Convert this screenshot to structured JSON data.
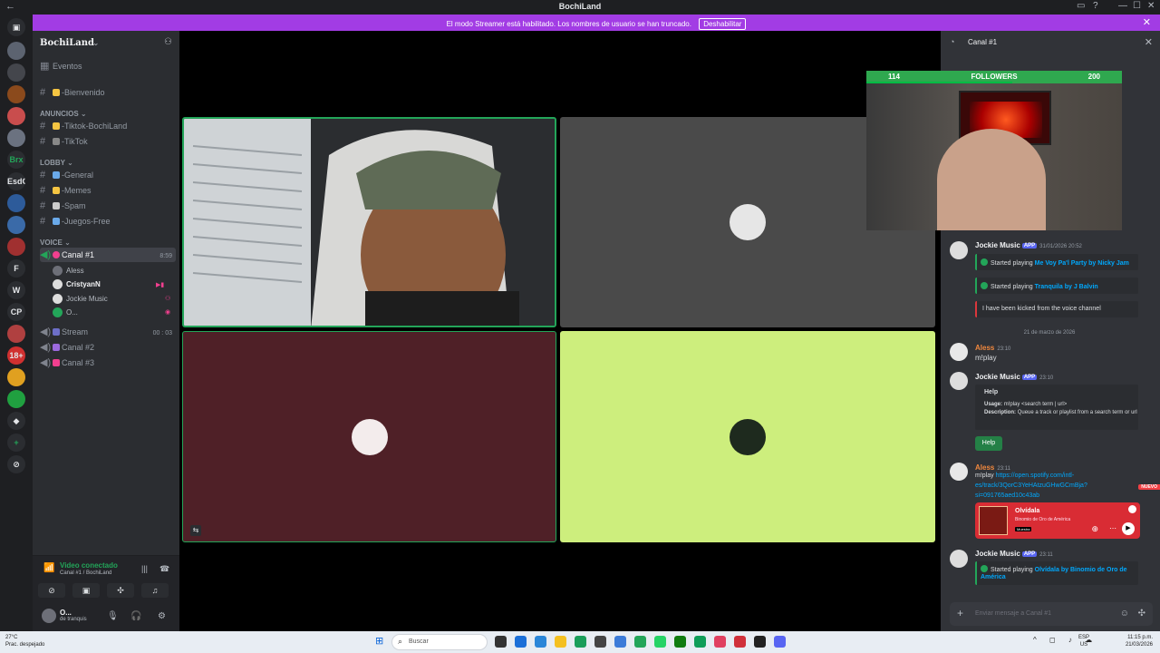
{
  "window": {
    "title": "BochiLand",
    "minimize": "—",
    "maximize": "☐",
    "close": "✕"
  },
  "banner": {
    "message": "El modo Streamer está habilitado. Los nombres de usuario se han truncado.",
    "button": "Deshabilitar"
  },
  "rail": {
    "items": [
      "",
      "",
      "",
      "",
      "",
      "",
      "",
      "Brx",
      "EsdC",
      "",
      "",
      "",
      "F",
      "W",
      "CP",
      "",
      "18+",
      "",
      "",
      "",
      "+",
      ""
    ]
  },
  "server": {
    "name": "BochiLand",
    "events": "Eventos",
    "channels": {
      "bienvenido": "-Bienvenido",
      "anuncios_cat": "ANUNCIOS",
      "tiktok": "-Tiktok-BochiLand",
      "tiktok2": "-TikTok",
      "lobby_cat": "LOBBY",
      "general": "-General",
      "memes": "-Memes",
      "spam": "-Spam",
      "juegos": "-Juegos-Free",
      "voice_cat": "VOICE",
      "canal1": "Canal #1",
      "canal1_time": "8:59",
      "stream": "Stream",
      "stream_time": "00 : 03",
      "canal2": "Canal #2",
      "canal3": "Canal #3"
    },
    "voice_members": [
      "Aless",
      "CristyanN",
      "Jockie Music",
      "O..."
    ]
  },
  "voice_panel": {
    "title": "Video conectado",
    "subtitle": "Canal #1 / BochiLand",
    "buttons": [
      "camera-off",
      "screen-share",
      "activities",
      "soundboard"
    ]
  },
  "user_panel": {
    "name": "O...",
    "status": "de tranquis"
  },
  "chat": {
    "channel": "Canal #1",
    "messages": [
      {
        "author": "Jockie Music",
        "app": "APP",
        "time": "31/01/2026 20:52"
      },
      {
        "line1_prefix": "Started playing ",
        "line1_link": "Me Voy Pa'l Party by Nicky Jam"
      },
      {
        "line_prefix": "Started playing ",
        "line_link": "Tranquila by J Balvin"
      },
      {
        "kicked": "I have been kicked from the voice channel"
      }
    ],
    "date_separator": "21 de marzo de 2026",
    "aless1": {
      "author": "Aless",
      "time": "23:10",
      "text": "m!play"
    },
    "jockie2": {
      "author": "Jockie Music",
      "app": "APP",
      "time": "23:10",
      "embed_title": "Help",
      "usage_label": "Usage:",
      "usage_text": "m!play <search term | url>",
      "desc_label": "Description:",
      "desc_text": "Queue a track or playlist from a search term or url",
      "button": "Help"
    },
    "new_badge": "NUEVO",
    "aless2": {
      "author": "Aless",
      "time": "23:11",
      "text_prefix": "m!play ",
      "link1": "https://open.spotify.com/intl-",
      "link2": "es/track/3QorC3YeHAtzuGHwGCmBja?",
      "link3": "si=091765aed10c43ab"
    },
    "spotify": {
      "title": "Olvídala",
      "artist": "Binomio de Oro de América",
      "preview": "Muestra"
    },
    "jockie3": {
      "author": "Jockie Music",
      "app": "APP",
      "time": "23:11",
      "prefix": "Started playing ",
      "link": "Olvídala by Binomio de Oro de",
      "link2": "América"
    },
    "input_placeholder": "Enviar mensaje a  Canal #1"
  },
  "overlay": {
    "followers_current": "114",
    "followers_label": "FOLLOWERS",
    "followers_goal": "200",
    "progress": 0.57
  },
  "taskbar": {
    "temp": "27°C",
    "weather": "Prac. despejado",
    "search": "Buscar",
    "lang1": "ESP",
    "lang2": "US",
    "time": "11:15 p.m.",
    "date": "21/03/2026"
  }
}
